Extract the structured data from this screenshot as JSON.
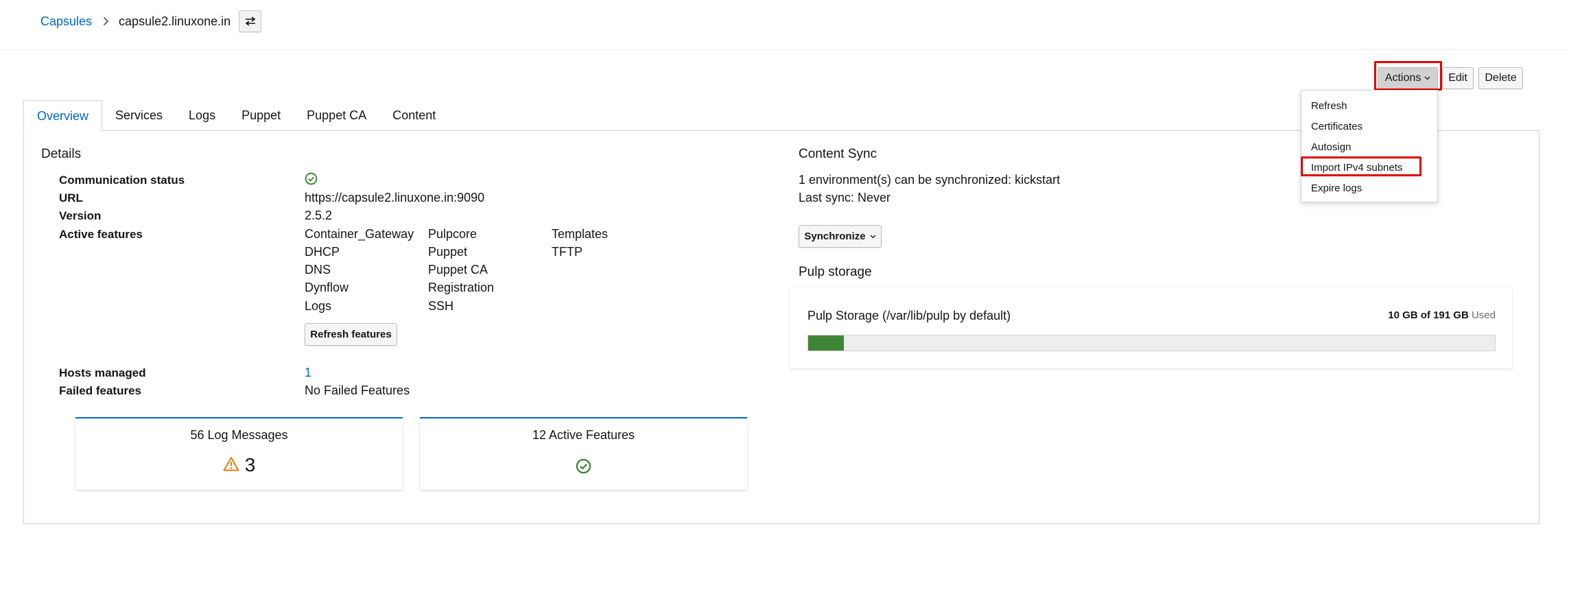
{
  "breadcrumb": {
    "parent": "Capsules",
    "current": "capsule2.linuxone.in"
  },
  "toolbar": {
    "actions_label": "Actions",
    "edit_label": "Edit",
    "delete_label": "Delete"
  },
  "actions_menu": {
    "items": [
      "Refresh",
      "Certificates",
      "Autosign",
      "Import IPv4 subnets",
      "Expire logs"
    ],
    "highlighted_item": "Import IPv4 subnets"
  },
  "tabs": [
    {
      "label": "Overview",
      "active": true
    },
    {
      "label": "Services",
      "active": false
    },
    {
      "label": "Logs",
      "active": false
    },
    {
      "label": "Puppet",
      "active": false
    },
    {
      "label": "Puppet CA",
      "active": false
    },
    {
      "label": "Content",
      "active": false
    }
  ],
  "details": {
    "title": "Details",
    "communication_status_label": "Communication status",
    "url_label": "URL",
    "url_value": "https://capsule2.linuxone.in:9090",
    "version_label": "Version",
    "version_value": "2.5.2",
    "active_features_label": "Active features",
    "active_features": [
      "Container_Gateway",
      "DHCP",
      "DNS",
      "Dynflow",
      "Logs",
      "Pulpcore",
      "Puppet",
      "Puppet CA",
      "Registration",
      "SSH",
      "Templates",
      "TFTP"
    ],
    "refresh_features_label": "Refresh features",
    "hosts_managed_label": "Hosts managed",
    "hosts_managed_value": "1",
    "failed_features_label": "Failed features",
    "failed_features_value": "No Failed Features"
  },
  "cards": {
    "log_messages_title": "56 Log Messages",
    "log_warning_count": "3",
    "active_features_title": "12 Active Features"
  },
  "content_sync": {
    "title": "Content Sync",
    "environments_text": "1 environment(s) can be synchronized: kickstart",
    "last_sync_text": "Last sync: Never",
    "synchronize_label": "Synchronize"
  },
  "pulp_storage": {
    "title": "Pulp storage",
    "label": "Pulp Storage (/var/lib/pulp by default)",
    "used_amount": "10 GB of 191 GB",
    "used_word": "Used",
    "used_fraction": 0.052
  },
  "colors": {
    "link": "#0066cc",
    "success": "#3e8635",
    "warning": "#ec7a08",
    "highlight": "#e00000"
  }
}
